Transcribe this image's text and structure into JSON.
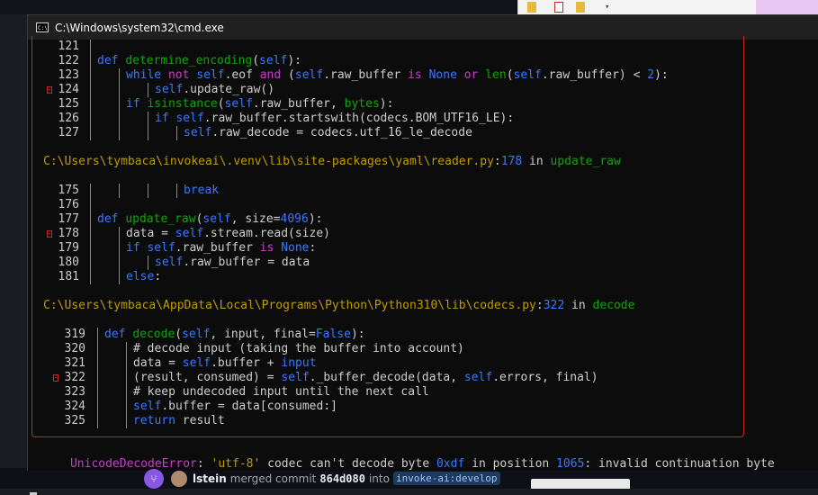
{
  "window": {
    "title": "C:\\Windows\\system32\\cmd.exe",
    "icon": "cmd-icon"
  },
  "traceback": {
    "block1": [
      {
        "no": "121",
        "marked": false,
        "indent": 0,
        "tokens": []
      },
      {
        "no": "122",
        "marked": false,
        "indent": 1,
        "tokens": [
          [
            "kw",
            "def "
          ],
          [
            "fn",
            "determine_encoding"
          ],
          [
            "plain",
            "("
          ],
          [
            "slf",
            "self"
          ],
          [
            "plain",
            "):"
          ]
        ]
      },
      {
        "no": "123",
        "marked": false,
        "indent": 2,
        "tokens": [
          [
            "kw",
            "while "
          ],
          [
            "kwr",
            "not "
          ],
          [
            "slf",
            "self"
          ],
          [
            "plain",
            ".eof "
          ],
          [
            "kwr",
            "and"
          ],
          [
            "plain",
            " ("
          ],
          [
            "slf",
            "self"
          ],
          [
            "plain",
            ".raw_buffer "
          ],
          [
            "kwr",
            "is "
          ],
          [
            "kw",
            "None "
          ],
          [
            "kwr",
            "or "
          ],
          [
            "fn",
            "len"
          ],
          [
            "plain",
            "("
          ],
          [
            "slf",
            "self"
          ],
          [
            "plain",
            ".raw_buffer) < "
          ],
          [
            "num",
            "2"
          ],
          [
            "plain",
            "):"
          ]
        ]
      },
      {
        "no": "124",
        "marked": true,
        "indent": 3,
        "tokens": [
          [
            "slf",
            "self"
          ],
          [
            "plain",
            ".update_raw()"
          ]
        ]
      },
      {
        "no": "125",
        "marked": false,
        "indent": 2,
        "tokens": [
          [
            "kw",
            "if "
          ],
          [
            "fn",
            "isinstance"
          ],
          [
            "plain",
            "("
          ],
          [
            "slf",
            "self"
          ],
          [
            "plain",
            ".raw_buffer, "
          ],
          [
            "fn",
            "bytes"
          ],
          [
            "plain",
            "):"
          ]
        ]
      },
      {
        "no": "126",
        "marked": false,
        "indent": 3,
        "tokens": [
          [
            "kw",
            "if "
          ],
          [
            "slf",
            "self"
          ],
          [
            "plain",
            ".raw_buffer.startswith(codecs.BOM_UTF16_LE):"
          ]
        ]
      },
      {
        "no": "127",
        "marked": false,
        "indent": 4,
        "tokens": [
          [
            "slf",
            "self"
          ],
          [
            "plain",
            ".raw_decode = codecs.utf_16_le_decode"
          ]
        ]
      }
    ],
    "path1": {
      "file": "C:\\Users\\tymbaca\\invokeai\\.venv\\lib\\site-packages\\yaml\\reader.py",
      "sep": ":",
      "line": "178",
      "in": " in ",
      "func": "update_raw"
    },
    "block2": [
      {
        "no": "175",
        "marked": false,
        "indent": 4,
        "tokens": [
          [
            "kw",
            "break"
          ]
        ]
      },
      {
        "no": "176",
        "marked": false,
        "indent": 0,
        "tokens": []
      },
      {
        "no": "177",
        "marked": false,
        "indent": 1,
        "tokens": [
          [
            "kw",
            "def "
          ],
          [
            "fn",
            "update_raw"
          ],
          [
            "plain",
            "("
          ],
          [
            "slf",
            "self"
          ],
          [
            "plain",
            ", size="
          ],
          [
            "num",
            "4096"
          ],
          [
            "plain",
            "):"
          ]
        ]
      },
      {
        "no": "178",
        "marked": true,
        "indent": 2,
        "tokens": [
          [
            "plain",
            "data = "
          ],
          [
            "slf",
            "self"
          ],
          [
            "plain",
            ".stream.read(size)"
          ]
        ]
      },
      {
        "no": "179",
        "marked": false,
        "indent": 2,
        "tokens": [
          [
            "kw",
            "if "
          ],
          [
            "slf",
            "self"
          ],
          [
            "plain",
            ".raw_buffer "
          ],
          [
            "kwr",
            "is "
          ],
          [
            "kw",
            "None"
          ],
          [
            "plain",
            ":"
          ]
        ]
      },
      {
        "no": "180",
        "marked": false,
        "indent": 3,
        "tokens": [
          [
            "slf",
            "self"
          ],
          [
            "plain",
            ".raw_buffer = data"
          ]
        ]
      },
      {
        "no": "181",
        "marked": false,
        "indent": 2,
        "tokens": [
          [
            "kw",
            "else"
          ],
          [
            "plain",
            ":"
          ]
        ]
      }
    ],
    "path2": {
      "file": "C:\\Users\\tymbaca\\AppData\\Local\\Programs\\Python\\Python310\\lib\\codecs.py",
      "sep": ":",
      "line": "322",
      "in": " in ",
      "func": "decode"
    },
    "block3": [
      {
        "no": "319",
        "marked": false,
        "indent": 1,
        "tokens": [
          [
            "kw",
            "def "
          ],
          [
            "fn",
            "decode"
          ],
          [
            "plain",
            "("
          ],
          [
            "slf",
            "self"
          ],
          [
            "plain",
            ", input, final="
          ],
          [
            "kw",
            "False"
          ],
          [
            "plain",
            "):"
          ]
        ]
      },
      {
        "no": "320",
        "marked": false,
        "indent": 2,
        "tokens": [
          [
            "plain",
            "# decode input (taking the buffer into account)"
          ]
        ]
      },
      {
        "no": "321",
        "marked": false,
        "indent": 2,
        "tokens": [
          [
            "plain",
            "data = "
          ],
          [
            "slf",
            "self"
          ],
          [
            "plain",
            ".buffer + "
          ],
          [
            "kw",
            "input"
          ]
        ]
      },
      {
        "no": "322",
        "marked": true,
        "indent": 2,
        "tokens": [
          [
            "plain",
            "(result, consumed) = "
          ],
          [
            "slf",
            "self"
          ],
          [
            "plain",
            "._buffer_decode(data, "
          ],
          [
            "slf",
            "self"
          ],
          [
            "plain",
            ".errors, final)"
          ]
        ]
      },
      {
        "no": "323",
        "marked": false,
        "indent": 2,
        "tokens": [
          [
            "plain",
            "# keep undecoded input until the next call"
          ]
        ]
      },
      {
        "no": "324",
        "marked": false,
        "indent": 2,
        "tokens": [
          [
            "slf",
            "self"
          ],
          [
            "plain",
            ".buffer = data[consumed:]"
          ]
        ]
      },
      {
        "no": "325",
        "marked": false,
        "indent": 2,
        "tokens": [
          [
            "kw",
            "return "
          ],
          [
            "plain",
            "result"
          ]
        ]
      }
    ]
  },
  "error": {
    "type": "UnicodeDecodeError",
    "colon": ": ",
    "q1": "'utf-8'",
    "mid": " codec can't decode byte ",
    "byte": "0xdf",
    "mid2": " in position ",
    "pos": "1065",
    "tail": ": invalid continuation byte"
  },
  "github": {
    "user": "lstein",
    "action": "merged commit",
    "commit": "864d080",
    "into": "into",
    "branch": "invoke-ai:develop"
  },
  "colors": {
    "keyword": "#3b78ff",
    "operator": "#c340c3",
    "function": "#13a10e",
    "path": "#c19c00",
    "error": "#c340c3",
    "frame_border": "#c62828"
  }
}
